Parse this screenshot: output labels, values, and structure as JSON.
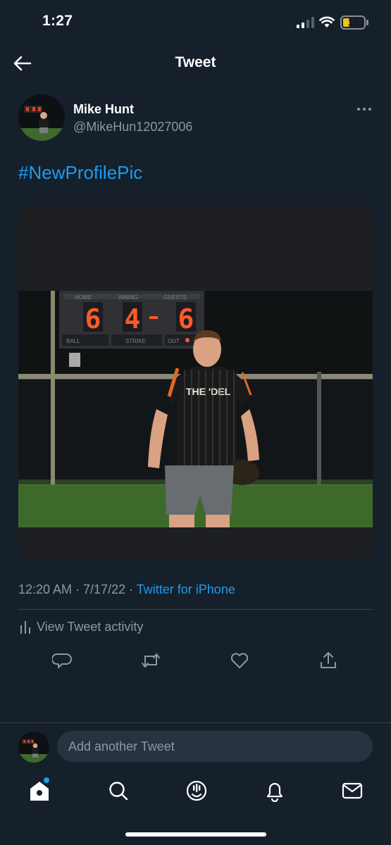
{
  "status_bar": {
    "time": "1:27",
    "battery": "13"
  },
  "header": {
    "title": "Tweet"
  },
  "author": {
    "name": "Mike Hunt",
    "handle": "@MikeHun12027006"
  },
  "tweet": {
    "text": "#NewProfilePic",
    "timestamp": "12:20 AM · 7/17/22 · ",
    "source": "Twitter for iPhone"
  },
  "photo": {
    "scoreboard": {
      "home": "6",
      "inning": "4",
      "guests": "6",
      "home_label": "HOME",
      "inning_label": "INNING",
      "guests_label": "GUESTS",
      "ball_label": "BALL",
      "strike_label": "STRIKE",
      "out_label": "OUT"
    },
    "jersey_text": "THE 'DEL"
  },
  "activity": {
    "label": "View Tweet activity"
  },
  "reply": {
    "placeholder": "Add another Tweet"
  },
  "icons": [
    "back-icon",
    "more-icon",
    "activity-icon",
    "reply-icon",
    "retweet-icon",
    "like-icon",
    "share-icon",
    "home-icon",
    "search-icon",
    "spaces-icon",
    "notifications-icon",
    "messages-icon"
  ],
  "colors": {
    "background": "#15202b",
    "accent": "#1d9bf0",
    "secondary_text": "#8b98a5",
    "battery": "#f0c419"
  }
}
